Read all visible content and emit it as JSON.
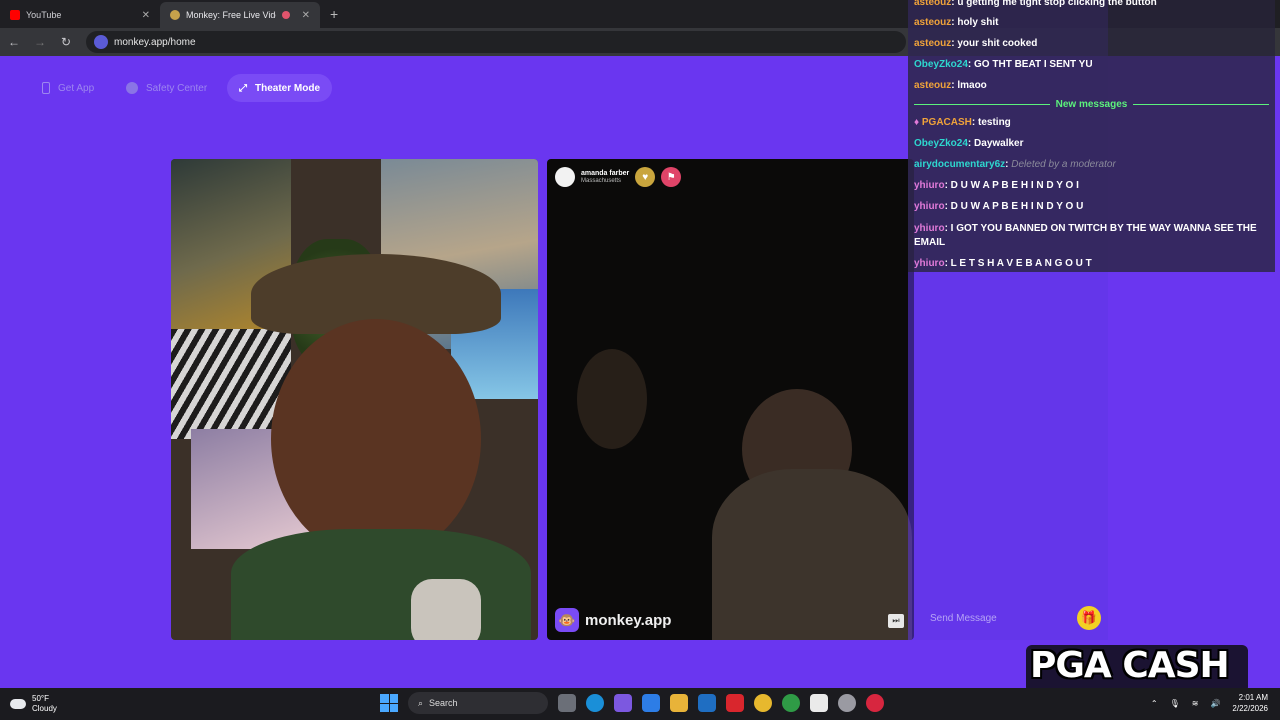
{
  "browser": {
    "tabs": [
      {
        "title": "YouTube",
        "fav_color": "#ff0000"
      },
      {
        "title": "Monkey: Free Live Video Ch",
        "fav_color": "#c7a24b"
      }
    ],
    "url": "monkey.app/home"
  },
  "app": {
    "buttons": {
      "get_app": "Get App",
      "safety_center": "Safety Center",
      "theater_mode": "Theater Mode"
    },
    "remote_user": {
      "name": "amanda farber",
      "location": "Massachusetts"
    },
    "brand": "monkey.app",
    "send_placeholder": "Send Message"
  },
  "chat": {
    "messages_before": [
      {
        "user": "asteouz",
        "text": "u getting me tight stop clicking the button",
        "color": "#f0a33a"
      },
      {
        "user": "asteouz",
        "text": "holy shit",
        "color": "#f0a33a"
      },
      {
        "user": "asteouz",
        "text": "your shit cooked",
        "color": "#f0a33a"
      },
      {
        "user": "ObeyZko24",
        "text": "GO THT BEAT I SENT YU",
        "color": "#2ed7cf"
      },
      {
        "user": "asteouz",
        "text": "lmaoo",
        "color": "#f0a33a"
      }
    ],
    "new_messages_label": "New messages",
    "messages_after": [
      {
        "user": "PGACASH",
        "text": "testing",
        "color": "#f0a33a"
      },
      {
        "user": "ObeyZko24",
        "text": "Daywalker",
        "color": "#2ed7cf"
      },
      {
        "user": "airydocumentary6z",
        "text": "Deleted by a moderator",
        "color": "#2ed7cf"
      },
      {
        "user": "yhiuro",
        "text": "D U W A P B E H I N D Y O I",
        "color": "#e07ad8"
      },
      {
        "user": "yhiuro",
        "text": "D U W A P B E H I N D Y O U",
        "color": "#e07ad8"
      },
      {
        "user": "yhiuro",
        "text": "I GOT YOU BANNED ON TWITCH BY THE WAY WANNA SEE THE EMAIL",
        "color": "#e07ad8"
      },
      {
        "user": "yhiuro",
        "text": "L E T S H A V E B A N G O U T",
        "color": "#e07ad8"
      }
    ]
  },
  "overlay_logo": "PGA CASH",
  "taskbar": {
    "weather_temp": "50°F",
    "weather_desc": "Cloudy",
    "search": "Search",
    "time": "2:01 AM",
    "date": "2/22/2026"
  }
}
